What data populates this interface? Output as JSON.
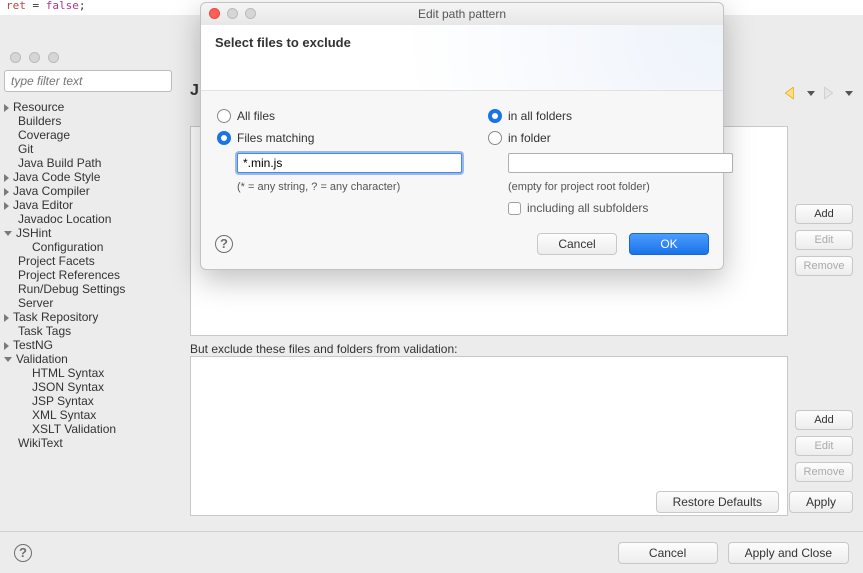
{
  "code_fragment": {
    "name": "ret",
    "eq": " = ",
    "val": "false",
    "semi": ";"
  },
  "prefs": {
    "filter_placeholder": "type filter text",
    "heading_char": "J"
  },
  "tree": [
    {
      "label": "Resource",
      "indent": 0,
      "arrow": "right",
      "interactable": true
    },
    {
      "label": "Builders",
      "indent": 1,
      "arrow": "",
      "interactable": true
    },
    {
      "label": "Coverage",
      "indent": 1,
      "arrow": "",
      "interactable": true
    },
    {
      "label": "Git",
      "indent": 1,
      "arrow": "",
      "interactable": true
    },
    {
      "label": "Java Build Path",
      "indent": 1,
      "arrow": "",
      "interactable": true
    },
    {
      "label": "Java Code Style",
      "indent": 0,
      "arrow": "right",
      "interactable": true
    },
    {
      "label": "Java Compiler",
      "indent": 0,
      "arrow": "right",
      "interactable": true
    },
    {
      "label": "Java Editor",
      "indent": 0,
      "arrow": "right",
      "interactable": true
    },
    {
      "label": "Javadoc Location",
      "indent": 1,
      "arrow": "",
      "interactable": true
    },
    {
      "label": "JSHint",
      "indent": 0,
      "arrow": "down",
      "interactable": true
    },
    {
      "label": "Configuration",
      "indent": 2,
      "arrow": "",
      "interactable": true
    },
    {
      "label": "Project Facets",
      "indent": 1,
      "arrow": "",
      "interactable": true
    },
    {
      "label": "Project References",
      "indent": 1,
      "arrow": "",
      "interactable": true
    },
    {
      "label": "Run/Debug Settings",
      "indent": 1,
      "arrow": "",
      "interactable": true
    },
    {
      "label": "Server",
      "indent": 1,
      "arrow": "",
      "interactable": true
    },
    {
      "label": "Task Repository",
      "indent": 0,
      "arrow": "right",
      "interactable": true
    },
    {
      "label": "Task Tags",
      "indent": 1,
      "arrow": "",
      "interactable": true
    },
    {
      "label": "TestNG",
      "indent": 0,
      "arrow": "right",
      "interactable": true
    },
    {
      "label": "Validation",
      "indent": 0,
      "arrow": "down",
      "interactable": true
    },
    {
      "label": "HTML Syntax",
      "indent": 2,
      "arrow": "",
      "interactable": true
    },
    {
      "label": "JSON Syntax",
      "indent": 2,
      "arrow": "",
      "interactable": true
    },
    {
      "label": "JSP Syntax",
      "indent": 2,
      "arrow": "",
      "interactable": true
    },
    {
      "label": "XML Syntax",
      "indent": 2,
      "arrow": "",
      "interactable": true
    },
    {
      "label": "XSLT Validation",
      "indent": 2,
      "arrow": "",
      "interactable": true
    },
    {
      "label": "WikiText",
      "indent": 1,
      "arrow": "",
      "interactable": true
    }
  ],
  "content": {
    "exclude_label": "But exclude these files and folders from validation:",
    "btn_add": "Add",
    "btn_edit": "Edit",
    "btn_remove": "Remove",
    "restore_defaults": "Restore Defaults",
    "apply": "Apply"
  },
  "footer": {
    "cancel": "Cancel",
    "apply_close": "Apply and Close"
  },
  "modal": {
    "title": "Edit path pattern",
    "header": "Select files to exclude",
    "radio_all_files": "All files",
    "radio_files_matching": "Files matching",
    "files_matching_value": "*.min.js",
    "files_hint": "(* = any string, ? = any character)",
    "radio_in_all": "in all folders",
    "radio_in_folder": "in folder",
    "folder_value": "",
    "folder_hint": "(empty for project root folder)",
    "chk_subfolders": "including all subfolders",
    "cancel": "Cancel",
    "ok": "OK"
  }
}
